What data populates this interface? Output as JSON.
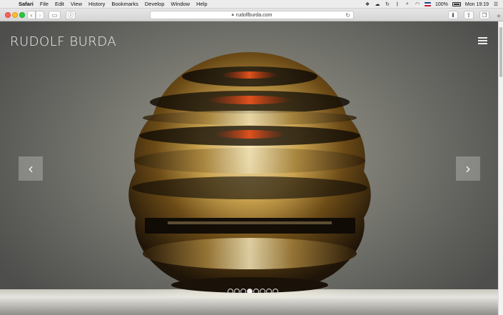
{
  "menubar": {
    "app": "Safari",
    "items": [
      "File",
      "Edit",
      "View",
      "History",
      "Bookmarks",
      "Develop",
      "Window",
      "Help"
    ],
    "battery": "100%",
    "clock": "Mon 19:19"
  },
  "browser": {
    "url": "rudolfburda.com"
  },
  "site": {
    "brand": "RUDOLF BURDA",
    "slide_count": 8,
    "active_slide": 4
  }
}
